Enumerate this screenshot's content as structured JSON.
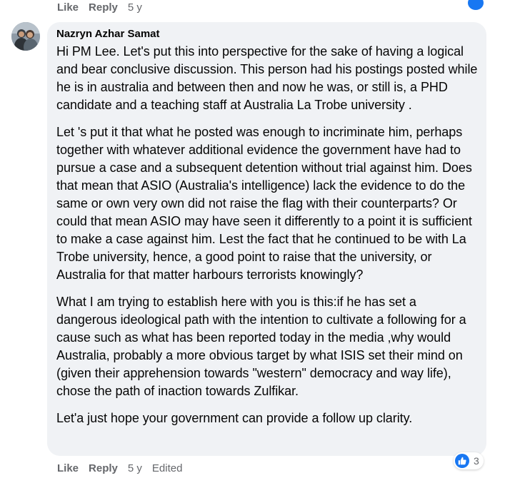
{
  "top_actions": {
    "like": "Like",
    "reply": "Reply",
    "time": "5 y"
  },
  "comment": {
    "author": "Nazryn Azhar Samat",
    "paragraphs": [
      "Hi PM Lee. Let's put this into perspective for the sake of having a logical and bear conclusive discussion. This person had his postings posted while he is in australia and between then and now he was, or still is, a PHD candidate and a teaching staff at Australia La Trobe university .",
      "Let 's put it that what he posted was enough to incriminate him, perhaps together with whatever additional evidence the government have had to pursue a case and a subsequent detention without trial against him. Does that mean that ASIO (Australia's intelligence) lack the evidence to do the same or own very own did not raise the flag with their counterparts? Or could that mean ASIO may have seen it differently to a point it is sufficient to make a case against him. Lest the fact that he continued to be with La Trobe university, hence, a good point to raise that the university, or Australia for that matter harbours terrorists knowingly?",
      "What I am trying to establish here with you is this:if he has set a dangerous ideological path with the intention to cultivate a following for a cause such as what has been reported today in the media ,why would Australia, probably a more obvious target by what ISIS set their mind on (given their apprehension towards \"western\" democracy and way life), chose the path of inaction towards Zulfikar.",
      "Let'a just hope your government can provide a follow up clarity."
    ],
    "reaction_count": "3",
    "actions": {
      "like": "Like",
      "reply": "Reply",
      "time": "5 y",
      "edited": "Edited"
    }
  },
  "colors": {
    "bubble": "#f0f2f5",
    "accent": "#1877f2",
    "meta": "#65676b",
    "text": "#050505"
  }
}
